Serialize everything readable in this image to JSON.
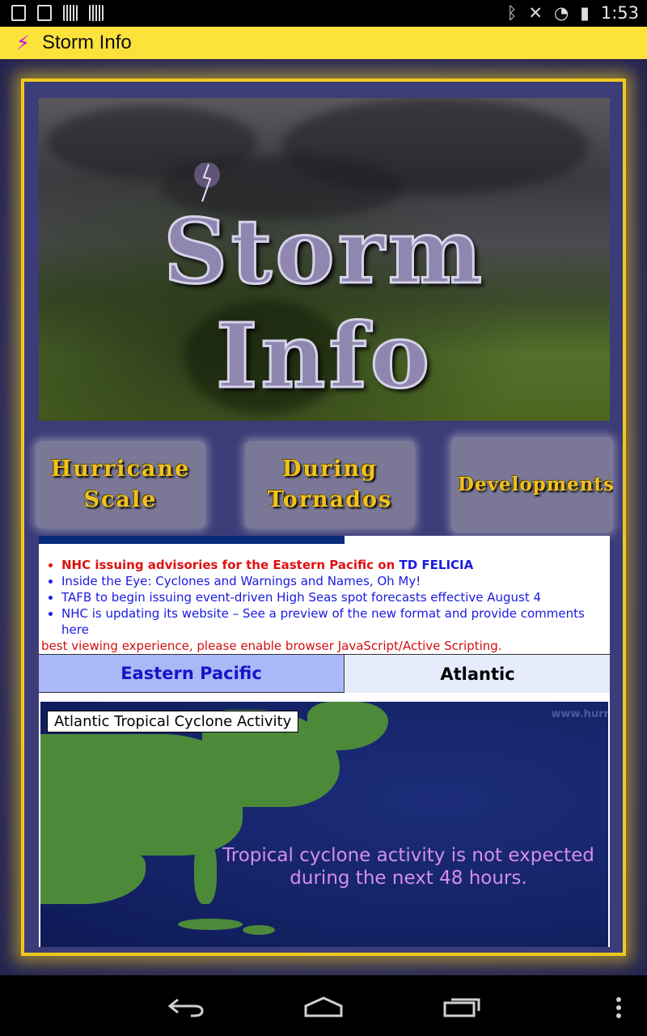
{
  "status_bar": {
    "time": "1:53",
    "icons": [
      "download-icon",
      "image-icon",
      "barcode-icon",
      "barcode-icon",
      "bluetooth-icon",
      "mute-icon",
      "wifi-icon",
      "battery-icon"
    ]
  },
  "action_bar": {
    "title": "Storm Info",
    "icon": "lightning-bolt-icon",
    "accent": "#fde23c"
  },
  "banner": {
    "title": "Storm Info"
  },
  "nav_buttons": [
    {
      "line1": "Hurricane",
      "line2": "Scale"
    },
    {
      "line1": "During",
      "line2": "Tornados"
    },
    {
      "line1": "Developments",
      "line2": ""
    }
  ],
  "news": {
    "items": [
      {
        "text": "NHC issuing advisories for the Eastern Pacific on ",
        "storm": "TD FELICIA"
      },
      {
        "text": "Inside the Eye: Cyclones and Warnings and Names, Oh My!"
      },
      {
        "text": "TAFB to begin issuing event-driven High Seas spot forecasts effective August 4"
      },
      {
        "text": "NHC is updating its website – See a preview of the new format and provide comments here"
      }
    ],
    "warning": "best viewing experience, please enable browser JavaScript/Active Scripting."
  },
  "tabs": {
    "eastern_pacific": "Eastern Pacific",
    "atlantic": "Atlantic"
  },
  "map": {
    "title": "Atlantic Tropical Cyclone Activity",
    "watermark": "www.hurricane",
    "message_line1": "Tropical cyclone activity is not expected",
    "message_line2": "during the next 48 hours."
  },
  "navigation_bar": {
    "icons": [
      "back-icon",
      "home-icon",
      "recent-apps-icon",
      "menu-icon"
    ]
  }
}
